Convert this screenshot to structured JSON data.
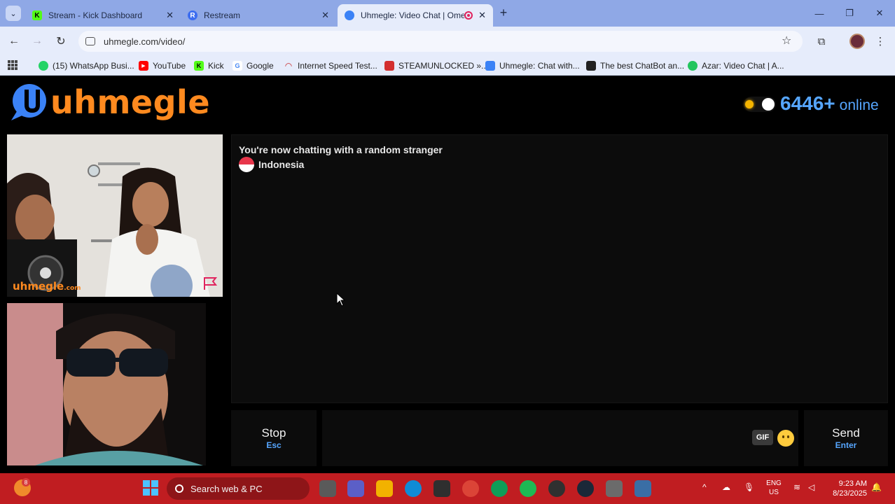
{
  "browser": {
    "tabs": [
      {
        "title": "Stream - Kick Dashboard",
        "favicon": "K",
        "favicon_color": "#53fc18",
        "active": false
      },
      {
        "title": "Restream",
        "favicon": "R",
        "favicon_color": "#3c6df0",
        "active": false
      },
      {
        "title": "Uhmegle: Video Chat | Ome",
        "favicon": "",
        "favicon_color": "#3b82f6",
        "active": true,
        "recording": true
      }
    ],
    "url": "uhmegle.com/video/",
    "bookmarks": [
      {
        "label": "(15) WhatsApp Busi...",
        "color": "#25d366",
        "glyph": ""
      },
      {
        "label": "YouTube",
        "color": "#ff0000",
        "glyph": "▶"
      },
      {
        "label": "Kick",
        "color": "#53fc18",
        "glyph": "K"
      },
      {
        "label": "Google",
        "color": "#ffffff",
        "glyph": "G"
      },
      {
        "label": "Internet Speed Test...",
        "color": "#e8eaf6",
        "glyph": ""
      },
      {
        "label": "STEAMUNLOCKED »...",
        "color": "#d32f2f",
        "glyph": ""
      },
      {
        "label": "Uhmegle: Chat with...",
        "color": "#3b82f6",
        "glyph": ""
      },
      {
        "label": "The best ChatBot an...",
        "color": "#222222",
        "glyph": ""
      },
      {
        "label": "Azar: Video Chat | A...",
        "color": "#22c55e",
        "glyph": ""
      }
    ]
  },
  "site": {
    "logo_text": "uhmegle",
    "online_count": "6446+",
    "online_label": "online",
    "accent_color": "#ff8a1f",
    "online_color": "#56a6ff"
  },
  "video": {
    "watermark": "uhmegle",
    "watermark_suffix": ".com"
  },
  "chat": {
    "status": "You're now chatting with a random stranger",
    "country": "Indonesia"
  },
  "controls": {
    "stop_label": "Stop",
    "stop_shortcut": "Esc",
    "gif_label": "GIF",
    "send_label": "Send",
    "send_shortcut": "Enter"
  },
  "taskbar": {
    "weather_badge": "8",
    "search_placeholder": "Search web & PC",
    "lang_line1": "ENG",
    "lang_line2": "US",
    "time": "9:23 AM",
    "date": "8/23/2025"
  }
}
